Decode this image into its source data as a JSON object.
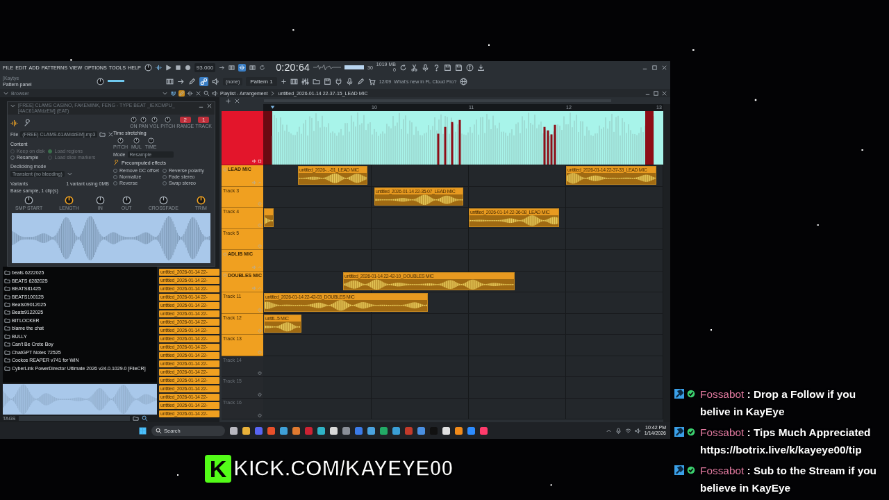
{
  "menu": [
    "FILE",
    "EDIT",
    "ADD",
    "PATTERNS",
    "VIEW",
    "OPTIONS",
    "TOOLS",
    "HELP"
  ],
  "transport": {
    "tempo": "93.000",
    "time": "0:20:64",
    "cpu": "30",
    "memory": "1019 MB",
    "voices": "0"
  },
  "pattern_panel": {
    "title": "[Kaytye",
    "label": "Pattern panel",
    "channel": "(none)",
    "pattern": "Pattern 1"
  },
  "news": {
    "date": "12/09",
    "text": "What's new in FL Cloud Pro?"
  },
  "browser": {
    "title": "Browser",
    "folders": [
      "beats 6222025",
      "BEATS 6282025",
      "BEATS81425",
      "BEATS100125",
      "Beats09012025",
      "Beats9122025",
      "BITLOCKER",
      "blame the chat",
      "BULLY",
      "Can't Be Crete Boy",
      "ChatGPT Notes 72525",
      "Cockos REAPER v741 for WiN",
      "CyberLink PowerDirector Ultimate 2026 v24.0.1029.0 [FileCR]"
    ],
    "tags_label": "TAGS"
  },
  "channel_settings": {
    "title": "[FREE] CLAMS CASINO, FAKEMINK, FENG - TYPE BEAT _IEXCMPU_ [4AC61AMdzEM] (EAT)",
    "knobs": [
      "ON",
      "PAN",
      "VOL",
      "PITCH"
    ],
    "range": {
      "value": "2",
      "label": "RANGE"
    },
    "track": {
      "value": "1",
      "label": "TRACK"
    },
    "file_label": "File",
    "file": "(FREE) CLAMS.61AMdzEM].mp3",
    "time_stretching": "Time stretching",
    "stretch_knobs": [
      "PITCH",
      "MUL",
      "TIME"
    ],
    "mode_label": "Mode",
    "mode": "Resample",
    "content_label": "Content",
    "content_options": [
      {
        "label": "Keep on disk",
        "checked": false,
        "disabled": true
      },
      {
        "label": "Load regions",
        "checked": true,
        "disabled": true
      },
      {
        "label": "Resample",
        "checked": false,
        "disabled": false
      },
      {
        "label": "Load slice markers",
        "checked": false,
        "disabled": true
      }
    ],
    "precomputed": "Precomputed effects",
    "effects": [
      {
        "label": "Remove DC offset",
        "checked": false
      },
      {
        "label": "Reverse polarity",
        "checked": false
      },
      {
        "label": "Normalize",
        "checked": false
      },
      {
        "label": "Fade stereo",
        "checked": false
      },
      {
        "label": "Reverse",
        "checked": false
      },
      {
        "label": "Swap stereo",
        "checked": false
      }
    ],
    "declicking_label": "Declicking mode",
    "declicking": "Transient (no bleeding)",
    "variants_label": "Variants",
    "variants_info": "1 variant using 0MB",
    "variant": "Base sample, 1 clip(s)",
    "envelope_knobs": [
      {
        "label": "SMP START",
        "active": false
      },
      {
        "label": "LENGTH",
        "active": true
      },
      {
        "label": "IN",
        "active": false
      },
      {
        "label": "OUT",
        "active": false
      },
      {
        "label": "CROSSFADE",
        "active": false
      },
      {
        "label": "TRIM",
        "active": true
      }
    ]
  },
  "pattern_clips": [
    "untitled_2026-01-14 22-",
    "untitled_2026-01-14 22-",
    "untitled_2026-01-14 22-",
    "untitled_2026-01-14 22-",
    "untitled_2026-01-14 22-",
    "untitled_2026-01-14 22-",
    "untitled_2026-01-14 22-",
    "untitled_2026-01-14 22-",
    "untitled_2026-01-14 22-",
    "untitled_2026-01-14 22-",
    "untitled_2026-01-14 22-",
    "untitled_2026-01-14 22-",
    "untitled_2026-01-14 22-",
    "untitled_2026-01-14 22-",
    "untitled_2026-01-14 22-",
    "untitled_2026-01-14 22-",
    "untitled_2026-01-14 22-",
    "untitled_2026-01-14 22-"
  ],
  "playlist": {
    "title": "Playlist - Arrangement",
    "project": "untitled_2026-01-14 22-37-15_LEAD MIC",
    "ruler": [
      "10",
      "11",
      "12",
      "13"
    ],
    "tracks": [
      {
        "kind": "audio",
        "color": "#e3152b"
      },
      {
        "kind": "group",
        "name": "LEAD MIC",
        "color": "#f0a020",
        "clips": [
          {
            "kind": "clip",
            "label": "untitled_2026-...-51_LEAD MIC"
          },
          {
            "kind": "clip",
            "label": "untitled_2026-01-14 22-37-33_LEAD MIC"
          }
        ]
      },
      {
        "kind": "track",
        "name": "Track 3",
        "color": "#f0a020",
        "clips": [
          {
            "kind": "clip",
            "label": "untitled_2026-01-14 22-35-07_LEAD MIC"
          }
        ]
      },
      {
        "kind": "track",
        "name": "Track 4",
        "color": "#f0a020",
        "clips": [
          {
            "kind": "clip"
          },
          {
            "kind": "clip",
            "label": "untitled_2026-01-14 22-36-08_LEAD MIC"
          }
        ]
      },
      {
        "kind": "track",
        "name": "Track 5",
        "color": "#f0a020"
      },
      {
        "kind": "group",
        "name": "ADLIB MIC",
        "color": "#f0a020"
      },
      {
        "kind": "group",
        "name": "DOUBLES MIC",
        "color": "#f0a020",
        "clips": [
          {
            "kind": "clip",
            "label": "untitled_2026-01-14 22-42-10_DOUBLES MIC"
          }
        ]
      },
      {
        "kind": "track",
        "name": "Track 11",
        "color": "#f0a020",
        "clips": [
          {
            "kind": "clip",
            "label": "untitled_2026-01-14 22-42-03_DOUBLES MIC"
          }
        ]
      },
      {
        "kind": "track",
        "name": "Track 12",
        "color": "#f0a020",
        "clips": [
          {
            "kind": "clip",
            "label": "untitl...5 MIC"
          }
        ]
      },
      {
        "kind": "track",
        "name": "Track 13",
        "color": "#f0a020"
      },
      {
        "kind": "track",
        "name": "Track 14",
        "color": "#26292d"
      },
      {
        "kind": "track",
        "name": "Track 15",
        "color": "#26292d"
      },
      {
        "kind": "track",
        "name": "Track 16",
        "color": "#26292d"
      }
    ]
  },
  "taskbar": {
    "search_placeholder": "Search",
    "time": "10:42 PM",
    "date": "1/14/2026"
  },
  "overlay": {
    "logo_letter": "K",
    "url": "KICK.COM/KAYEYE00"
  },
  "chat": [
    {
      "user": "Fossabot",
      "message": ": Drop a Follow if you belive in KayEye"
    },
    {
      "user": "Fossabot",
      "message": ": Tips Much Appreciated https://botrix.live/k/kayeye00/tip"
    },
    {
      "user": "Fossabot",
      "message": ": Sub to the Stream if you believe in KayEye"
    }
  ]
}
